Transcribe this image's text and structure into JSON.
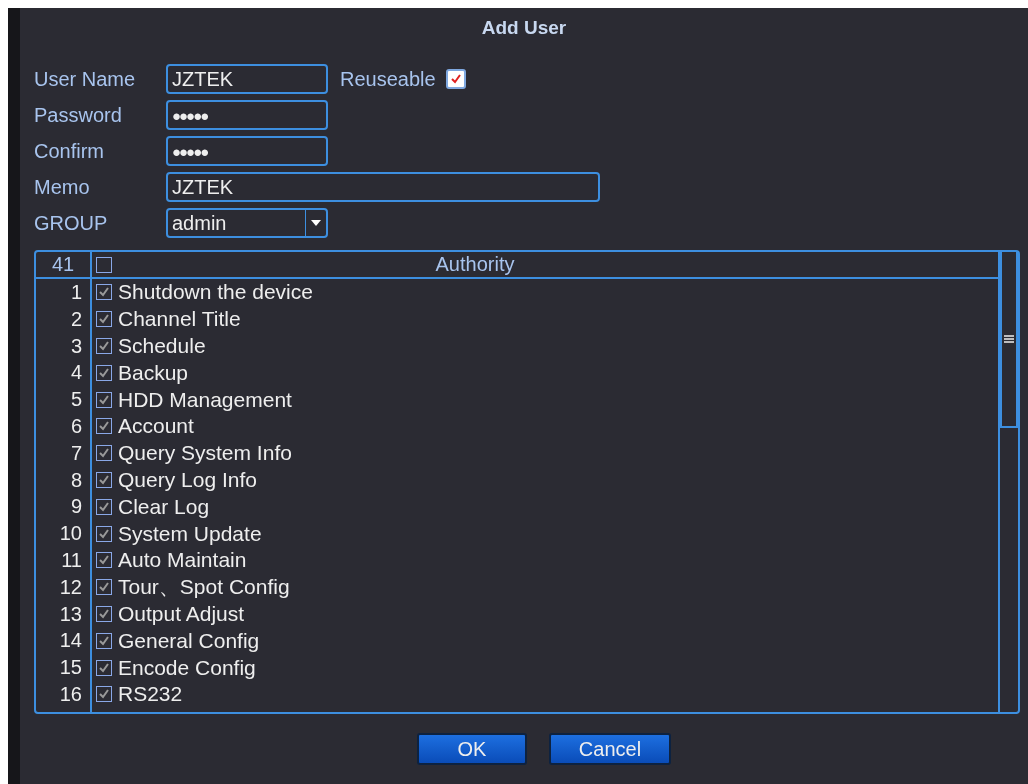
{
  "dialog": {
    "title": "Add User"
  },
  "form": {
    "user_name": {
      "label": "User Name",
      "value": "JZTEK"
    },
    "reuseable": {
      "label": "Reuseable",
      "checked": true
    },
    "password": {
      "label": "Password",
      "value": "●●●●●"
    },
    "confirm": {
      "label": "Confirm",
      "value": "●●●●●"
    },
    "memo": {
      "label": "Memo",
      "value": "JZTEK"
    },
    "group": {
      "label": "GROUP",
      "value": "admin"
    }
  },
  "table": {
    "count": "41",
    "all_checked": false,
    "column": "Authority",
    "rows": [
      {
        "index": "1",
        "name": "Shutdown the device",
        "checked": true
      },
      {
        "index": "2",
        "name": "Channel Title",
        "checked": true
      },
      {
        "index": "3",
        "name": "Schedule",
        "checked": true
      },
      {
        "index": "4",
        "name": "Backup",
        "checked": true
      },
      {
        "index": "5",
        "name": "HDD Management",
        "checked": true
      },
      {
        "index": "6",
        "name": "Account",
        "checked": true
      },
      {
        "index": "7",
        "name": "Query System Info",
        "checked": true
      },
      {
        "index": "8",
        "name": "Query Log Info",
        "checked": true
      },
      {
        "index": "9",
        "name": "Clear Log",
        "checked": true
      },
      {
        "index": "10",
        "name": "System Update",
        "checked": true
      },
      {
        "index": "11",
        "name": "Auto Maintain",
        "checked": true
      },
      {
        "index": "12",
        "name": "Tour、Spot Config",
        "checked": true
      },
      {
        "index": "13",
        "name": "Output Adjust",
        "checked": true
      },
      {
        "index": "14",
        "name": "General Config",
        "checked": true
      },
      {
        "index": "15",
        "name": "Encode Config",
        "checked": true
      },
      {
        "index": "16",
        "name": "RS232",
        "checked": true
      }
    ]
  },
  "buttons": [
    "OK",
    "Cancel"
  ]
}
